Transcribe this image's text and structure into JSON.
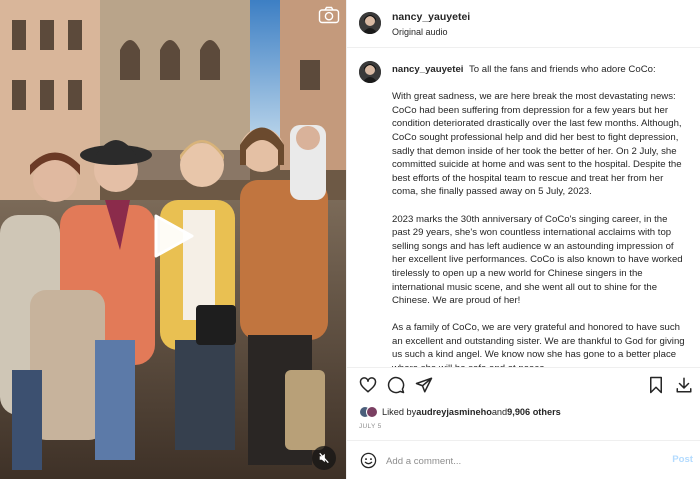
{
  "post": {
    "username": "nancy_yauyetei",
    "audio_label": "Original audio"
  },
  "caption": {
    "username": "nancy_yauyetei",
    "intro": "To all the fans and friends who adore CoCo:",
    "p1": "With great sadness, we are here break the most devastating news: CoCo had been suffering from depression for a few years but her condition deteriorated drastically over the last few months. Although, CoCo sought professional help and did her best to fight depression, sadly that demon inside of her took the better of her. On 2 July, she committed suicide at home and was sent to the hospital. Despite the best efforts of the hospital team to rescue and treat her from her coma, she finally passed away on 5 July, 2023.",
    "p2": "2023 marks the 30th anniversary of CoCo's singing career, in the past 29 years, she's won countless international acclaims with top selling songs and has left audience w an astounding impression of her excellent live performances. CoCo is also known to have worked tirelessly to open up a new world for Chinese singers in the international music scene, and she went all out to shine for the Chinese. We are proud of her!",
    "p3": "As a family of CoCo, we are very grateful and honored to have such an excellent and outstanding sister. We are thankful to God for giving us such a kind angel. We know now she has gone to a better place where she will be safe and at peace."
  },
  "likes": {
    "prefix": "Liked by ",
    "user": "audreyjasmineho",
    "middle": " and ",
    "count": "9,906 others"
  },
  "date": "JULY 5",
  "comment": {
    "placeholder": "Add a comment...",
    "post_label": "Post"
  },
  "icons": {
    "camera": "camera-icon",
    "play": "play-icon",
    "mute": "audio-muted-icon",
    "like": "heart-icon",
    "comment": "comment-icon",
    "share": "share-icon",
    "save": "bookmark-icon",
    "download": "download-icon",
    "emoji": "emoji-icon"
  },
  "colors": {
    "post_button": "#b3dbff",
    "muted_text": "#8e8e8e",
    "divider": "#efefef"
  }
}
